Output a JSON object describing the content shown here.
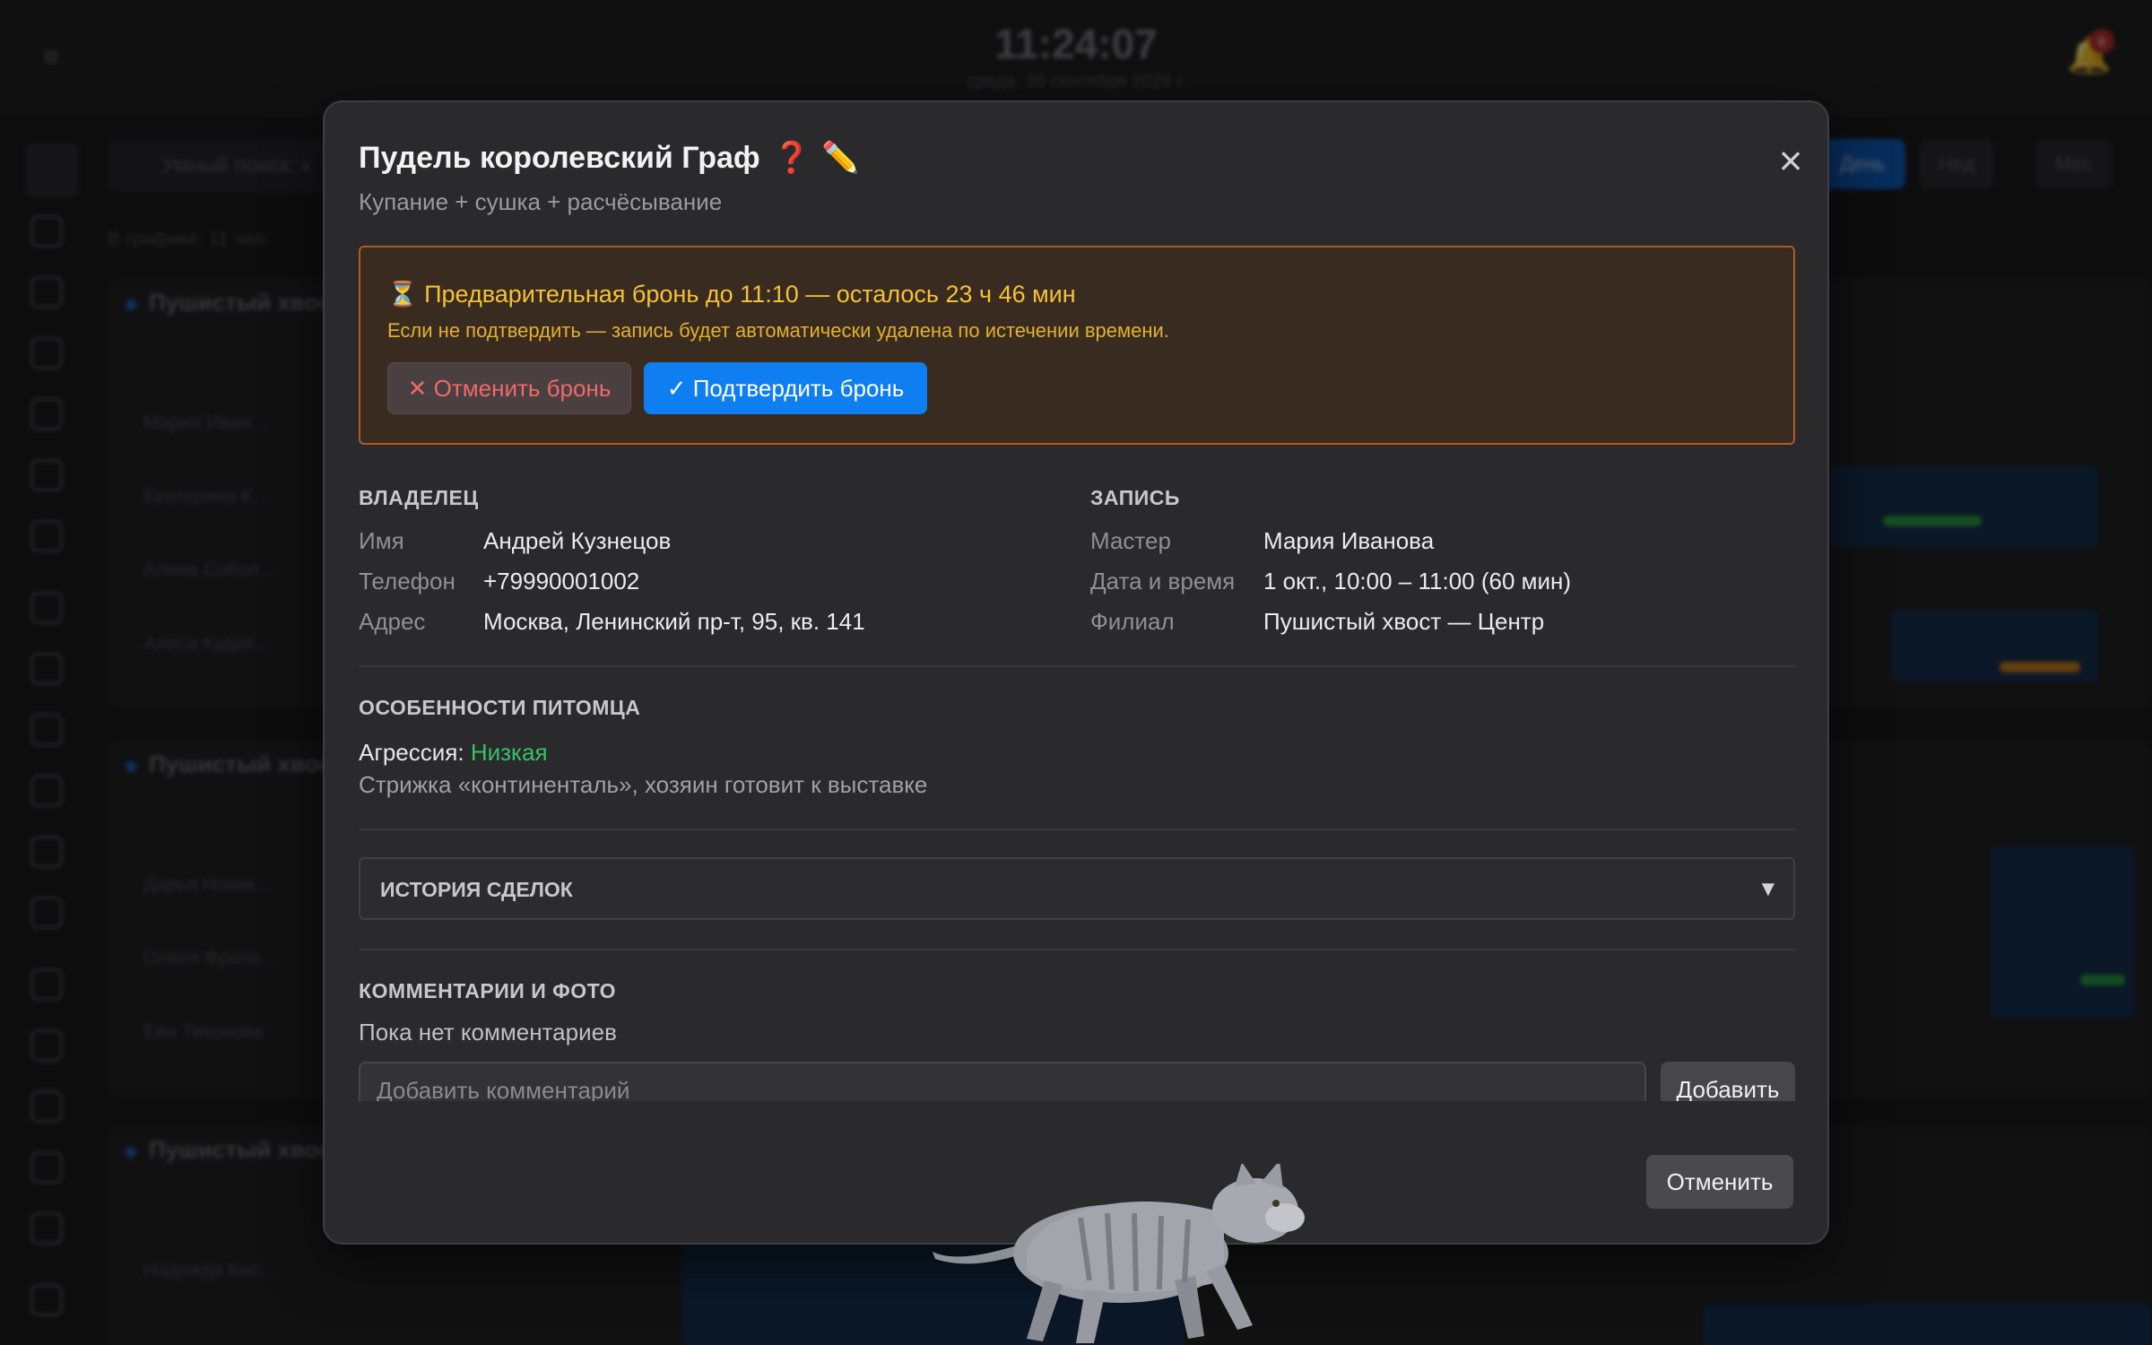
{
  "header": {
    "time": "11:24:07",
    "date": "среда, 30 сентября 2026 г.",
    "notifications": "6"
  },
  "background": {
    "search_placeholder": "Умный поиск: к",
    "schedule_count": "В графике: 11 чел.",
    "view_day": "День",
    "view_week": "Нед",
    "view_month": "Мес",
    "branches": [
      {
        "title": "Пушистый хвост",
        "employees": [
          "Мария Иван…",
          "Екатерина К…",
          "Алина Собол…",
          "Алиса Кудря…"
        ]
      },
      {
        "title": "Пушистый хвост",
        "employees": [
          "Дарья Новик…",
          "Олеся Фроло…",
          "Ева Тихонова"
        ]
      },
      {
        "title": "Пушистый хвост",
        "employees": [
          "Надежда Кис…"
        ]
      }
    ]
  },
  "modal": {
    "title": "Пудель королевский Граф",
    "subtitle": "Купание + сушка + расчёсывание",
    "hold": {
      "title": "⏳ Предварительная бронь до 11:10 — осталось 23 ч 46 мин",
      "text": "Если не подтвердить — запись будет автоматически удалена по истечении времени.",
      "cancel_label": "✕ Отменить бронь",
      "confirm_label": "✓ Подтвердить бронь"
    },
    "owner": {
      "heading": "ВЛАДЕЛЕЦ",
      "rows": [
        {
          "k": "Имя",
          "v": "Андрей Кузнецов"
        },
        {
          "k": "Телефон",
          "v": "+79990001002"
        },
        {
          "k": "Адрес",
          "v": "Москва, Ленинский пр-т, 95, кв. 141"
        }
      ]
    },
    "booking": {
      "heading": "ЗАПИСЬ",
      "rows": [
        {
          "k": "Мастер",
          "v": "Мария Иванова"
        },
        {
          "k": "Дата и время",
          "v": "1 окт., 10:00 – 11:00 (60 мин)"
        },
        {
          "k": "Филиал",
          "v": "Пушистый хвост — Центр"
        }
      ]
    },
    "pet": {
      "heading": "ОСОБЕННОСТИ ПИТОМЦА",
      "aggression_label": "Агрессия:",
      "aggression_value": "Низкая",
      "note": "Стрижка «континенталь», хозяин готовит к выставке"
    },
    "history": {
      "label": "ИСТОРИЯ СДЕЛОК"
    },
    "comments": {
      "heading": "КОММЕНТАРИИ И ФОТО",
      "empty": "Пока нет комментариев",
      "placeholder": "Добавить комментарий",
      "add_label": "Добавить"
    },
    "cancel_label": "Отменить"
  },
  "colors": {
    "accent": "#0f7ef0",
    "warning": "#f2c238",
    "danger": "#ef6a68",
    "success": "#36c167"
  }
}
